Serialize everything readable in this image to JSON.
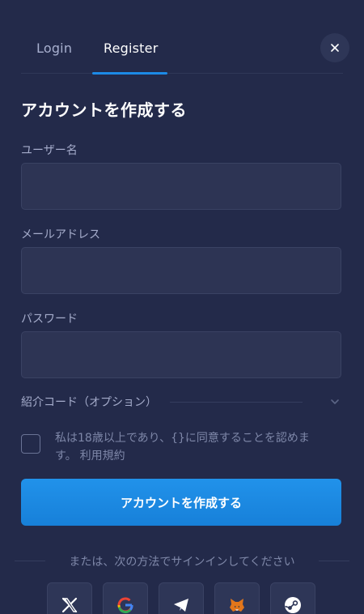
{
  "tabs": {
    "login": "Login",
    "register": "Register"
  },
  "close": {
    "icon": "close-icon"
  },
  "form": {
    "title": "アカウントを作成する",
    "username_label": "ユーザー名",
    "username_value": "",
    "email_label": "メールアドレス",
    "email_value": "",
    "password_label": "パスワード",
    "password_value": "",
    "referral_label": "紹介コード（オプション）",
    "consent_text": "私は18歳以上であり、{}に同意することを認めます。",
    "terms_link": "利用規約",
    "consent_checked": false,
    "submit_label": "アカウントを作成する"
  },
  "social": {
    "divider_text": "または、次の方法でサインインしてください",
    "providers": [
      "x-icon",
      "google-icon",
      "telegram-icon",
      "metamask-icon",
      "steam-icon"
    ]
  },
  "colors": {
    "background": "#232a4a",
    "accent": "#1c8ae6",
    "field_bg": "#2d3454",
    "muted_text": "#a5accb"
  }
}
